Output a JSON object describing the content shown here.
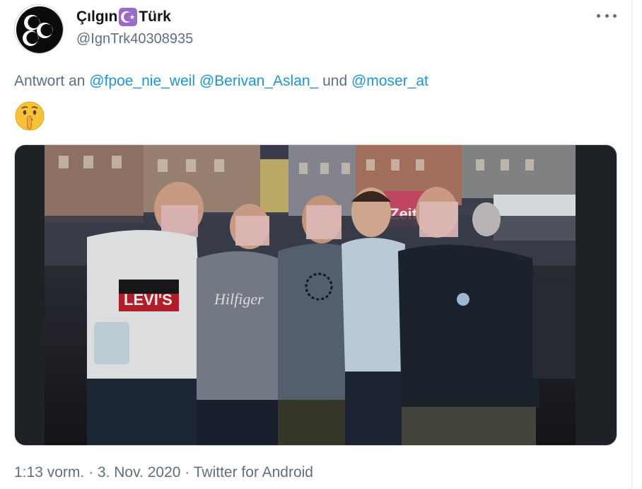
{
  "tweet": {
    "display_name_part1": "Çılgın",
    "display_name_part2": "Türk",
    "badge_icon": "star-and-crescent-icon",
    "handle": "@IgnTrk40308935",
    "reply_prefix": "Antwort an",
    "mentions": [
      "@fpoe_nie_weil",
      "@Berivan_Aslan_",
      "@moser_at"
    ],
    "reply_conjunction": "und",
    "emoji": "shushing-face-emoji",
    "photo_description_icon": "group-photo",
    "tshirt_text": "LEVI'S",
    "tshirt_text_2": "Hilfiger",
    "banner_text": "Zeit",
    "time": "1:13 vorm.",
    "separator": "·",
    "date": "3. Nov. 2020",
    "source": "Twitter for Android"
  },
  "colors": {
    "link": "#1b95e0",
    "secondary_text": "#5b7083",
    "primary_text": "#0f1419",
    "badge": "#9b6bcc"
  }
}
